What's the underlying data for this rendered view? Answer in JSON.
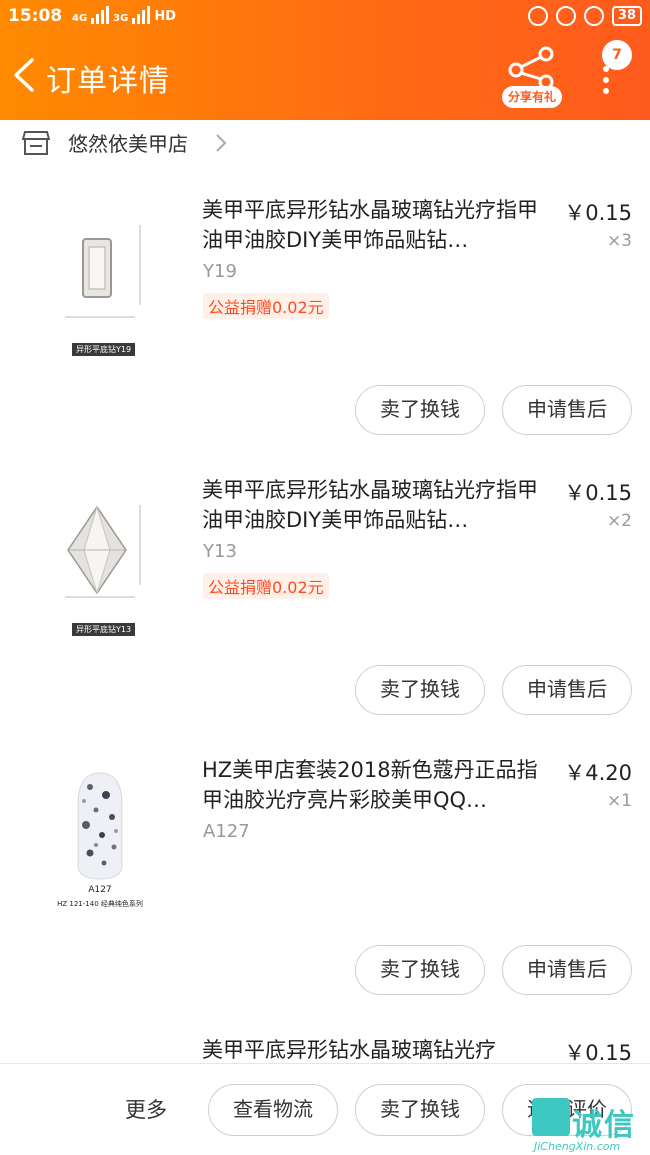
{
  "status_bar": {
    "time": "15:08",
    "network_1": "4G",
    "network_2": "3G",
    "hd": "HD",
    "battery": "38"
  },
  "header": {
    "title": "订单详情",
    "share_label": "分享有礼",
    "message_count": "7"
  },
  "store": {
    "name": "悠然依美甲店"
  },
  "items": [
    {
      "title": "美甲平底异形钻水晶玻璃钻光疗指甲油甲油胶DIY美甲饰品贴钻…",
      "sku": "Y19",
      "price": "￥0.15",
      "quantity": "×3",
      "donation": "公益捐赠0.02元",
      "thumb_caption": "异形平底钻Y19",
      "sell_label": "卖了换钱",
      "after_sale_label": "申请售后"
    },
    {
      "title": "美甲平底异形钻水晶玻璃钻光疗指甲油甲油胶DIY美甲饰品贴钻…",
      "sku": "Y13",
      "price": "￥0.15",
      "quantity": "×2",
      "donation": "公益捐赠0.02元",
      "thumb_caption": "异形平底钻Y13",
      "sell_label": "卖了换钱",
      "after_sale_label": "申请售后"
    },
    {
      "title": "HZ美甲店套装2018新色蔻丹正品指甲油胶光疗亮片彩胶美甲QQ…",
      "sku": "A127",
      "price": "￥4.20",
      "quantity": "×1",
      "thumb_caption": "A127",
      "thumb_caption_sub": "HZ 121-140 经典纯色系列",
      "sell_label": "卖了换钱",
      "after_sale_label": "申请售后"
    },
    {
      "title": "美甲平底异形钻水晶玻璃钻光疗",
      "price": "￥0.15"
    }
  ],
  "bottom_bar": {
    "more": "更多",
    "logistics": "查看物流",
    "sell": "卖了换钱",
    "review": "追加评价"
  },
  "watermark": {
    "text": "诚信",
    "url": "JiChengXin.com"
  },
  "colors": {
    "brand_orange": "#ff6a14",
    "donation_red": "#ff4b1f"
  }
}
